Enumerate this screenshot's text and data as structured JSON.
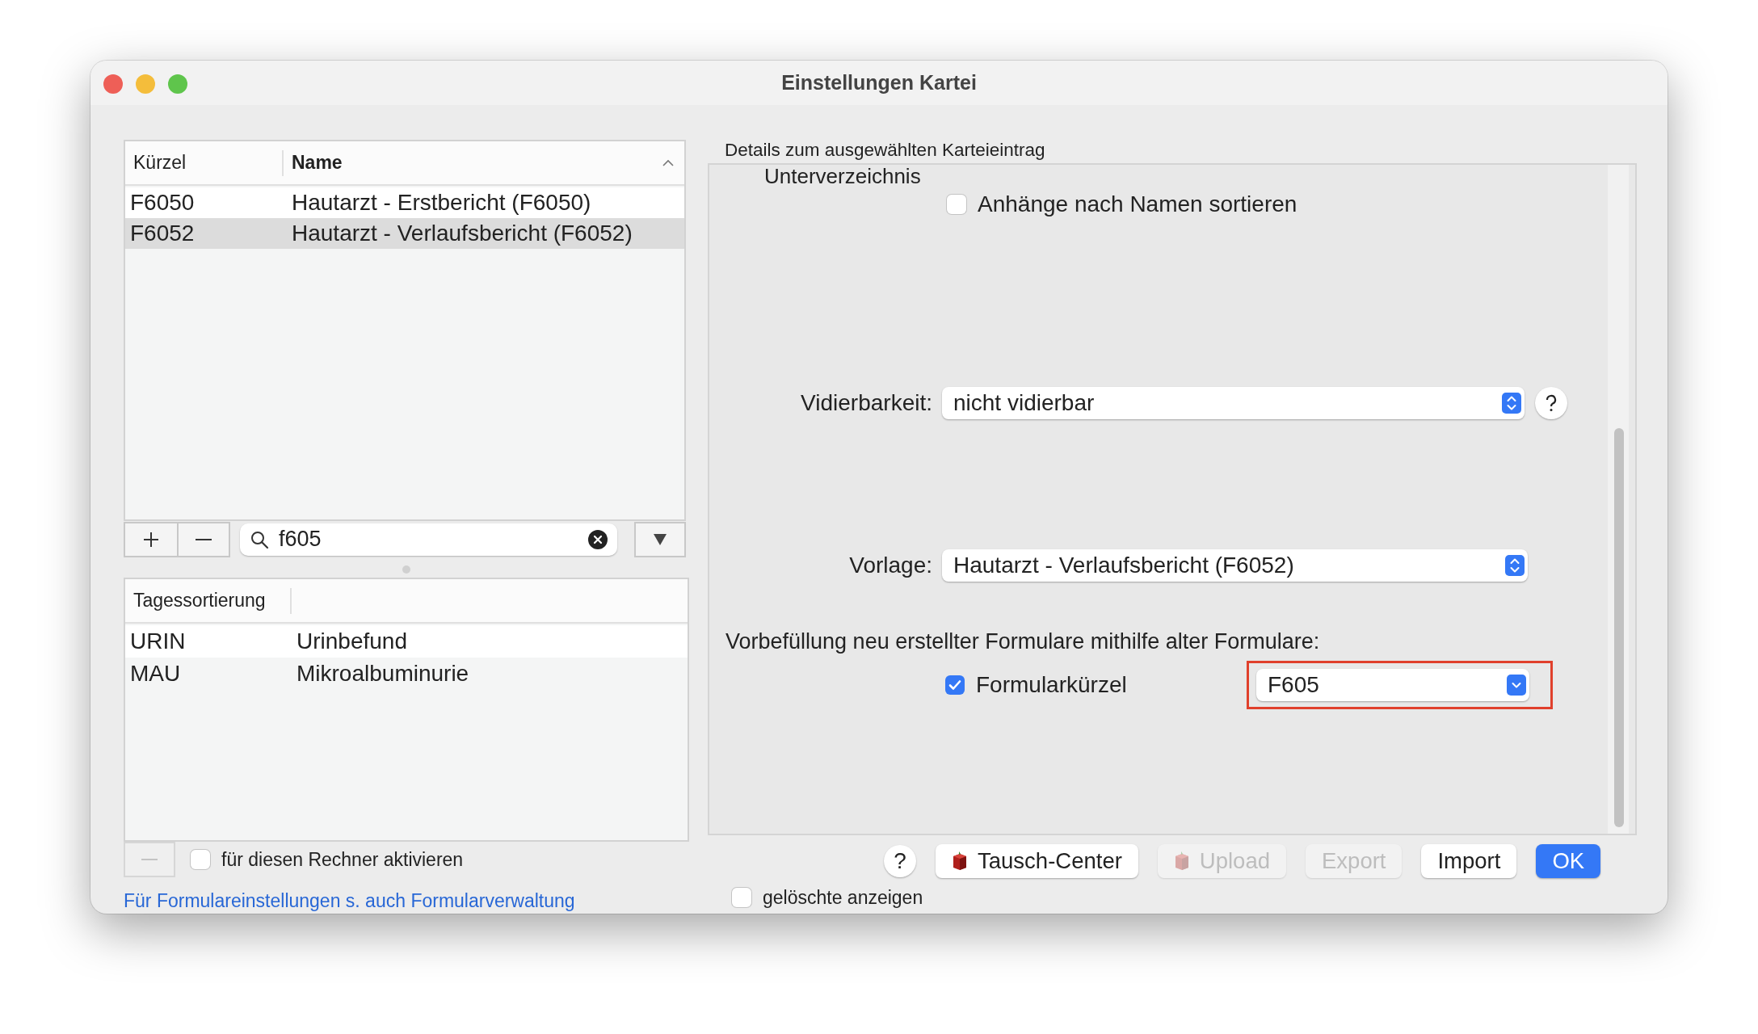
{
  "window": {
    "title": "Einstellungen Kartei"
  },
  "forms_table": {
    "columns": [
      {
        "label": "Kürzel",
        "sorted": false
      },
      {
        "label": "Name",
        "sorted": true
      }
    ],
    "rows": [
      {
        "code": "F6050",
        "name": "Hautarzt - Erstbericht (F6050)",
        "selected": false
      },
      {
        "code": "F6052",
        "name": "Hautarzt - Verlaufsbericht (F6052)",
        "selected": true
      }
    ]
  },
  "search": {
    "value": "f605"
  },
  "sort_table": {
    "columns": [
      {
        "label": "Tagessortierung"
      }
    ],
    "rows": [
      {
        "code": "URIN",
        "name": "Urinbefund",
        "selected": false
      },
      {
        "code": "MAU",
        "name": "Mikroalbuminurie",
        "selected": false
      }
    ]
  },
  "activate_checkbox": {
    "label": "für diesen Rechner aktivieren",
    "checked": false
  },
  "link": "Für Formulareinstellungen s. auch Formularverwaltung",
  "details": {
    "title": "Details zum ausgewählten Karteieintrag",
    "section_label": "Unterverzeichnis",
    "sort_attachments": {
      "label": "Anhänge nach Namen sortieren",
      "checked": false
    },
    "vidierbarkeit": {
      "label": "Vidierbarkeit:",
      "value": "nicht vidierbar"
    },
    "vorlage": {
      "label": "Vorlage:",
      "value": "Hautarzt - Verlaufsbericht (F6052)"
    },
    "prefill_label": "Vorbefüllung neu erstellter Formulare mithilfe alter Formulare:",
    "prefill_checkbox": {
      "label": "Formularkürzel",
      "checked": true
    },
    "prefill_select": {
      "value": "F605",
      "highlighted": true
    }
  },
  "buttons": [
    {
      "label": "?",
      "kind": "help"
    },
    {
      "label": "Tausch-Center",
      "kind": "icon",
      "disabled": false
    },
    {
      "label": "Upload",
      "kind": "icon",
      "disabled": true
    },
    {
      "label": "Export",
      "kind": "plain",
      "disabled": true
    },
    {
      "label": "Import",
      "kind": "plain",
      "disabled": false
    },
    {
      "label": "OK",
      "kind": "default",
      "disabled": false
    }
  ],
  "show_deleted": {
    "label": "gelöschte anzeigen",
    "checked": false
  }
}
